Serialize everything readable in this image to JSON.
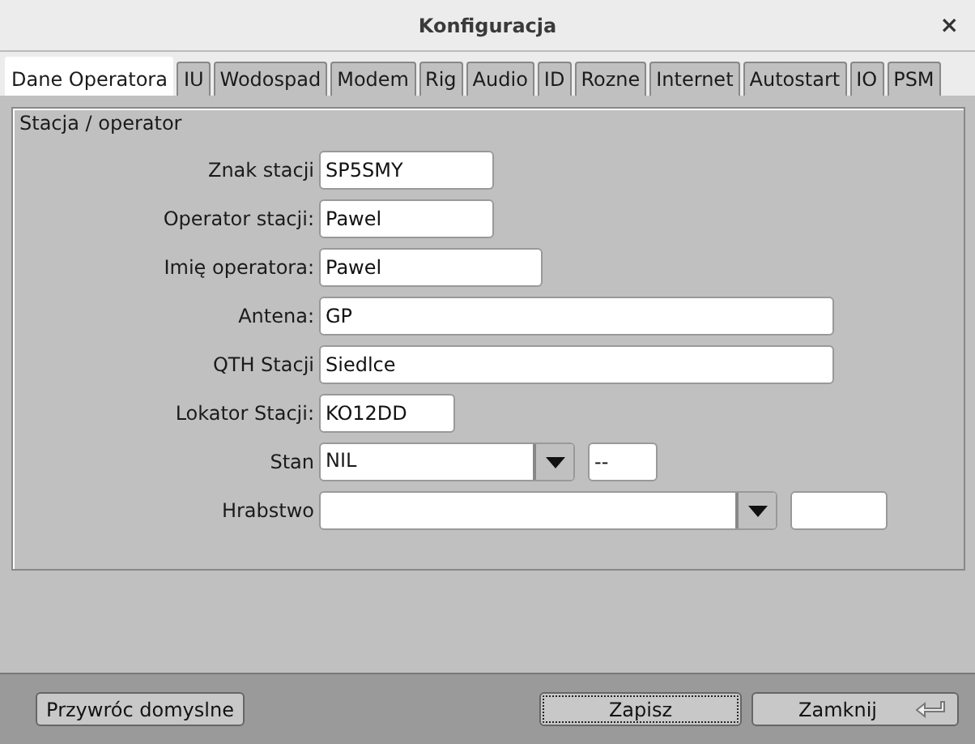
{
  "window": {
    "title": "Konfiguracja",
    "close": "×"
  },
  "tabs": [
    {
      "label": "Dane Operatora",
      "selected": true
    },
    {
      "label": "IU",
      "selected": false
    },
    {
      "label": "Wodospad",
      "selected": false
    },
    {
      "label": "Modem",
      "selected": false
    },
    {
      "label": "Rig",
      "selected": false
    },
    {
      "label": "Audio",
      "selected": false
    },
    {
      "label": "ID",
      "selected": false
    },
    {
      "label": "Rozne",
      "selected": false
    },
    {
      "label": "Internet",
      "selected": false
    },
    {
      "label": "Autostart",
      "selected": false
    },
    {
      "label": "IO",
      "selected": false
    },
    {
      "label": "PSM",
      "selected": false
    }
  ],
  "group": {
    "title": "Stacja / operator",
    "fields": [
      {
        "kind": "text",
        "label": "Znak stacji",
        "value": "SP5SMY"
      },
      {
        "kind": "text",
        "label": "Operator stacji:",
        "value": "Pawel"
      },
      {
        "kind": "text",
        "label": "Imię operatora:",
        "value": "Pawel"
      },
      {
        "kind": "text",
        "label": "Antena:",
        "value": "GP"
      },
      {
        "kind": "text",
        "label": "QTH Stacji",
        "value": "Siedlce"
      },
      {
        "kind": "text",
        "label": "Lokator Stacji:",
        "value": "KO12DD"
      },
      {
        "kind": "combo",
        "label": "Stan",
        "value": "NIL",
        "extra": "--"
      },
      {
        "kind": "combo",
        "label": "Hrabstwo"
      }
    ]
  },
  "buttons": [
    {
      "label": "Przywróc domyslne",
      "focused": false
    },
    {
      "label": "Zapisz",
      "focused": true
    },
    {
      "label": "Zamknij",
      "focused": false
    }
  ]
}
